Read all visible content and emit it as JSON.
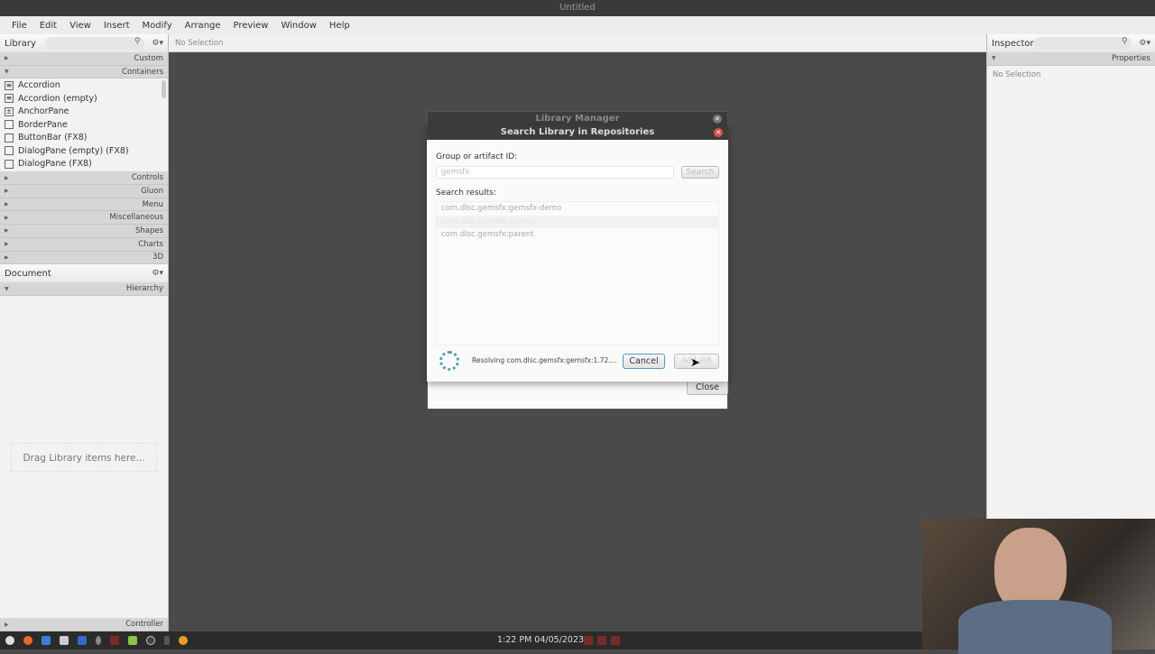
{
  "window": {
    "title": "Untitled"
  },
  "menu": [
    "File",
    "Edit",
    "View",
    "Insert",
    "Modify",
    "Arrange",
    "Preview",
    "Window",
    "Help"
  ],
  "library": {
    "title": "Library",
    "sections_top": [
      {
        "label": "Custom",
        "open": false
      },
      {
        "label": "Containers",
        "open": true
      }
    ],
    "items": [
      {
        "label": "Accordion",
        "icon": "accordion-icon"
      },
      {
        "label": "Accordion  (empty)",
        "icon": "accordion-icon"
      },
      {
        "label": "AnchorPane",
        "icon": "anchorpane-icon"
      },
      {
        "label": "BorderPane",
        "icon": "borderpane-icon"
      },
      {
        "label": "ButtonBar  (FX8)",
        "icon": "buttonbar-icon"
      },
      {
        "label": "DialogPane (empty)  (FX8)",
        "icon": "dialogpane-icon"
      },
      {
        "label": "DialogPane  (FX8)",
        "icon": "dialogpane-icon"
      }
    ],
    "sections": [
      "Controls",
      "Gluon",
      "Menu",
      "Miscellaneous",
      "Shapes",
      "Charts",
      "3D"
    ]
  },
  "document": {
    "title": "Document",
    "section": "Hierarchy",
    "drop_hint": "Drag Library items here...",
    "footer": "Controller"
  },
  "center": {
    "selection": "No Selection"
  },
  "inspector": {
    "title": "Inspector",
    "section": "Properties",
    "selection": "No Selection"
  },
  "library_manager": {
    "title": "Library Manager",
    "close": "Close"
  },
  "search_dialog": {
    "title": "Search Library in Repositories",
    "field_label": "Group or artifact ID:",
    "field_value": "gemsfx",
    "search": "Search",
    "results_label": "Search results:",
    "results": [
      "com.dlsc.gemsfx:gemsfx-demo",
      "com.dlsc.gemsfx:gemsfx",
      "com.dlsc.gemsfx:parent"
    ],
    "status": "Resolving com.dlsc.gemsfx:gemsfx:1.72....",
    "cancel": "Cancel",
    "add_jar": "Add JAR"
  },
  "taskbar": {
    "clock": "1:22 PM 04/05/2023"
  },
  "colors": {
    "dialog_close": "#d9534f",
    "cancel_border": "#5b9bb8",
    "dark_bg": "#4a4a4a"
  }
}
